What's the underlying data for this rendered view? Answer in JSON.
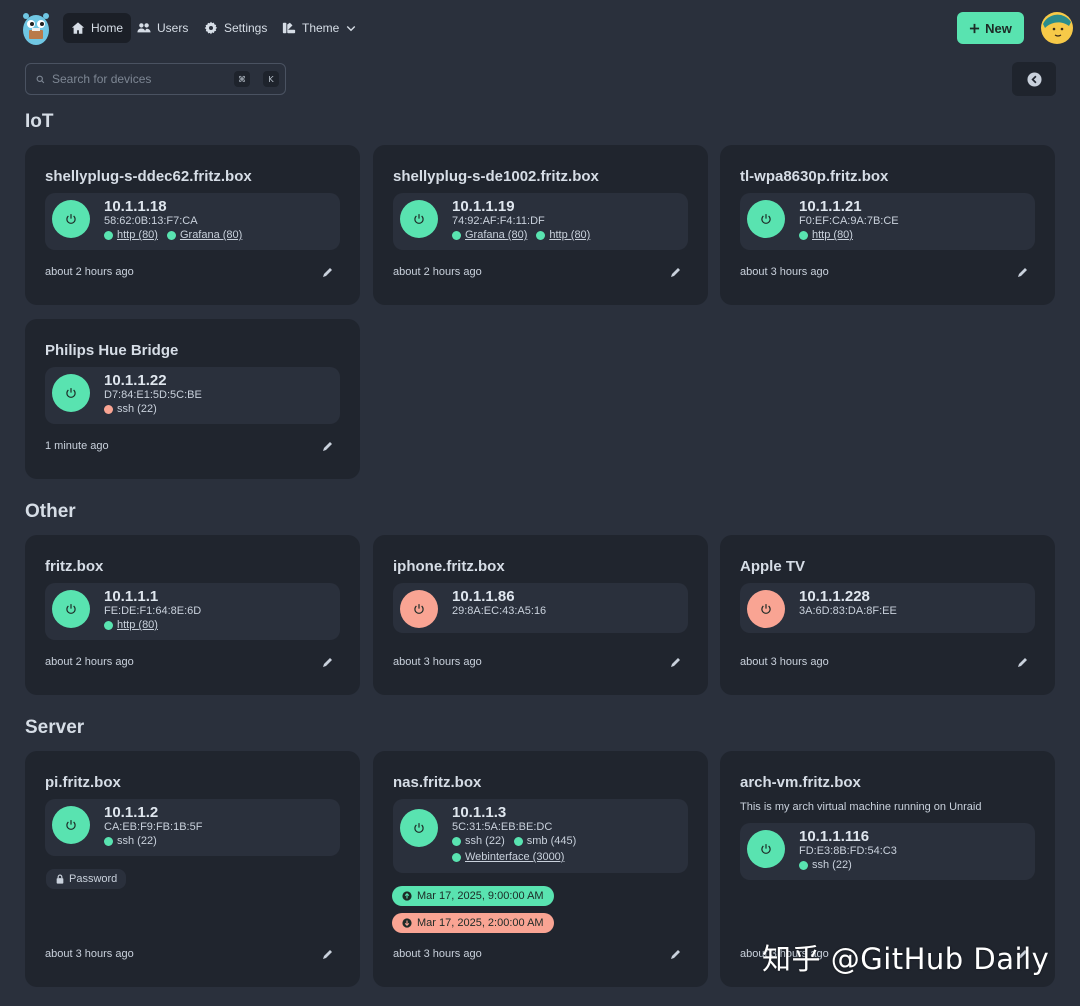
{
  "nav": {
    "home": "Home",
    "users": "Users",
    "settings": "Settings",
    "theme": "Theme",
    "new_button": "New"
  },
  "search": {
    "placeholder": "Search for devices",
    "kbd_cmd": "⌘",
    "kbd_key": "K"
  },
  "sections": {
    "iot": "IoT",
    "other": "Other",
    "server": "Server"
  },
  "cards": {
    "c1": {
      "name": "shellyplug-s-ddec62.fritz.box",
      "ip": "10.1.1.18",
      "mac": "58:62:0B:13:F7:CA",
      "p1": "http (80)",
      "p2": "Grafana (80)",
      "time": "about 2 hours ago"
    },
    "c2": {
      "name": "shellyplug-s-de1002.fritz.box",
      "ip": "10.1.1.19",
      "mac": "74:92:AF:F4:11:DF",
      "p1": "Grafana (80)",
      "p2": "http (80)",
      "time": "about 2 hours ago"
    },
    "c3": {
      "name": "tl-wpa8630p.fritz.box",
      "ip": "10.1.1.21",
      "mac": "F0:EF:CA:9A:7B:CE",
      "p1": "http (80)",
      "time": "about 3 hours ago"
    },
    "c4": {
      "name": "Philips Hue Bridge",
      "ip": "10.1.1.22",
      "mac": "D7:84:E1:5D:5C:BE",
      "p1": "ssh (22)",
      "time": "1 minute ago"
    },
    "c5": {
      "name": "fritz.box",
      "ip": "10.1.1.1",
      "mac": "FE:DE:F1:64:8E:6D",
      "p1": "http (80)",
      "time": "about 2 hours ago"
    },
    "c6": {
      "name": "iphone.fritz.box",
      "ip": "10.1.1.86",
      "mac": "29:8A:EC:43:A5:16",
      "time": "about 3 hours ago"
    },
    "c7": {
      "name": "Apple TV",
      "ip": "10.1.1.228",
      "mac": "3A:6D:83:DA:8F:EE",
      "time": "about 3 hours ago"
    },
    "c8": {
      "name": "pi.fritz.box",
      "ip": "10.1.1.2",
      "mac": "CA:EB:F9:FB:1B:5F",
      "p1": "ssh (22)",
      "badge": "Password",
      "time": "about 3 hours ago"
    },
    "c9": {
      "name": "nas.fritz.box",
      "ip": "10.1.1.3",
      "mac": "5C:31:5A:EB:BE:DC",
      "p1": "ssh (22)",
      "p2": "smb (445)",
      "p3": "Webinterface (3000)",
      "wake": "Mar 17, 2025, 9:00:00 AM",
      "shutdown": "Mar 17, 2025, 2:00:00 AM",
      "time": "about 3 hours ago"
    },
    "c10": {
      "name": "arch-vm.fritz.box",
      "description": "This is my arch virtual machine running on Unraid",
      "ip": "10.1.1.116",
      "mac": "FD:E3:8B:FD:54:C3",
      "p1": "ssh (22)",
      "time": "about 3 hours ago"
    }
  },
  "watermark": "知乎 @GitHub Daily",
  "colors": {
    "accent": "#59e3b0",
    "offline": "#f9a493",
    "background": "#2a303c",
    "card": "#20252e"
  }
}
